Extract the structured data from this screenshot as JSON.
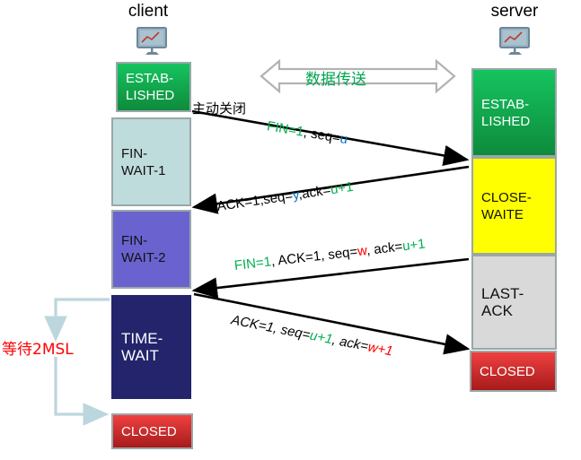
{
  "diagram": {
    "title_client": "client",
    "title_server": "server",
    "icon_client": "monitor-chart-icon",
    "icon_server": "monitor-chart-icon",
    "data_transfer_label": "数据传送",
    "active_close_label": "主动关闭",
    "wait_2msl_label": "等待2MSL",
    "colors": {
      "green": "#00b050",
      "blue": "#0070c0",
      "red": "#ff0000",
      "black": "#000000",
      "established": "#15c45f",
      "fin_wait_1": "#bfdcdc",
      "fin_wait_2": "#6a63cf",
      "time_wait": "#23246b",
      "closed": "#f04040",
      "close_waite": "#ffff00",
      "last_ack": "#d9d9d9",
      "msl_arrow": "#bcd6dd"
    }
  },
  "client_states": [
    {
      "name": "client-state-established",
      "line1": "ESTAB-",
      "line2": "LISHED"
    },
    {
      "name": "client-state-fin-wait-1",
      "line1": "FIN-",
      "line2": "WAIT-1"
    },
    {
      "name": "client-state-fin-wait-2",
      "line1": "FIN-",
      "line2": "WAIT-2"
    },
    {
      "name": "client-state-time-wait",
      "line1": "TIME-",
      "line2": "WAIT"
    },
    {
      "name": "client-state-closed",
      "line1": "CLOSED",
      "line2": ""
    }
  ],
  "server_states": [
    {
      "name": "server-state-established",
      "line1": "ESTAB-",
      "line2": "LISHED"
    },
    {
      "name": "server-state-close-waite",
      "line1": "CLOSE-",
      "line2": "WAITE"
    },
    {
      "name": "server-state-last-ack",
      "line1": "LAST-",
      "line2": "ACK"
    },
    {
      "name": "server-state-closed",
      "line1": "CLOSED",
      "line2": ""
    }
  ],
  "messages": [
    {
      "name": "message-fin-seq-u",
      "direction": "client-to-server",
      "parts": [
        {
          "text": "FIN=1",
          "color": "green"
        },
        {
          "text": ", seq=",
          "color": "black"
        },
        {
          "text": "u",
          "color": "blue"
        }
      ]
    },
    {
      "name": "message-ack-seq-y-ack-u1",
      "direction": "server-to-client",
      "parts": [
        {
          "text": "ACK=1,seq=",
          "color": "black"
        },
        {
          "text": "y",
          "color": "blue"
        },
        {
          "text": ",ack=",
          "color": "black"
        },
        {
          "text": "u+1",
          "color": "green"
        }
      ]
    },
    {
      "name": "message-fin-ack-seq-w-ack-u1",
      "direction": "server-to-client",
      "parts": [
        {
          "text": "FIN=1",
          "color": "green"
        },
        {
          "text": ", ACK=1, seq=",
          "color": "black"
        },
        {
          "text": "w",
          "color": "red"
        },
        {
          "text": ", ack=",
          "color": "black"
        },
        {
          "text": "u+1",
          "color": "green"
        }
      ]
    },
    {
      "name": "message-ack-seq-u1-ack-w1",
      "direction": "client-to-server",
      "parts": [
        {
          "text": "ACK=1, seq=",
          "color": "black"
        },
        {
          "text": "u+1",
          "color": "green"
        },
        {
          "text": ", ack=",
          "color": "black"
        },
        {
          "text": "w+1",
          "color": "red"
        }
      ]
    }
  ]
}
